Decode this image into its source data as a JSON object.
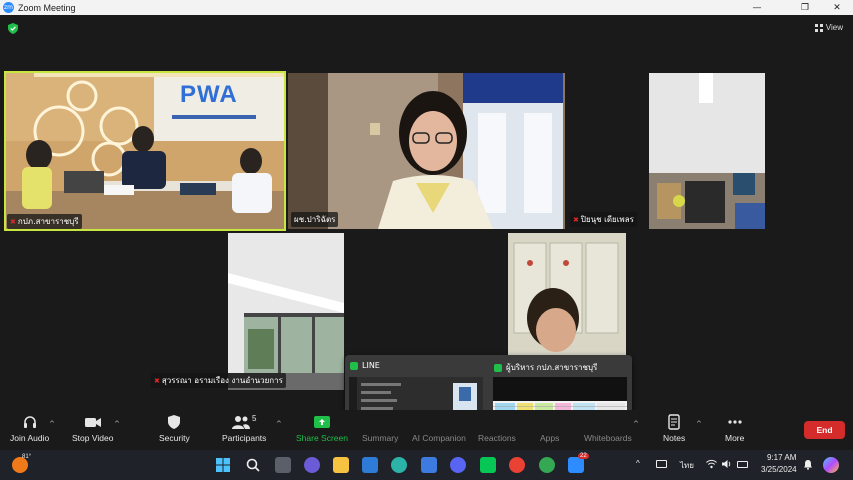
{
  "window": {
    "app_icon": "zm",
    "title": "Zoom Meeting",
    "minimize": "—",
    "maximize": "❐",
    "close": "✕"
  },
  "top": {
    "view_label": "View"
  },
  "participants_tiles": [
    {
      "name": "กปภ.สาขาราชบุรี",
      "muted": true
    },
    {
      "name": "ผช.ปาริฉัตร",
      "muted": false
    },
    {
      "name": "ปิยนุช เดียเพลร",
      "muted": true
    },
    {
      "name": "สุวรรณา อรามเรือง งานอำนวยการ",
      "muted": true
    }
  ],
  "video_text": {
    "logo": "PWA"
  },
  "popup": {
    "left_title": "LINE",
    "right_title": "ผู้บริหาร กปภ.สาขาราชบุรี"
  },
  "toolbar": {
    "join_audio": "Join Audio",
    "stop_video": "Stop Video",
    "security": "Security",
    "participants": "Participants",
    "participants_count": "5",
    "share_screen": "Share Screen",
    "summary": "Summary",
    "ai_companion": "AI Companion",
    "reactions": "Reactions",
    "apps": "Apps",
    "whiteboards": "Whiteboards",
    "notes": "Notes",
    "more": "More",
    "end": "End"
  },
  "taskbar": {
    "weather": "81°",
    "lang": "ไทย",
    "time": "9:17 AM",
    "date": "3/25/2024",
    "zoom_badge": "22"
  },
  "colors": {
    "accent": "#c8e640",
    "share": "#1fbf4a",
    "end": "#d42b2b"
  }
}
